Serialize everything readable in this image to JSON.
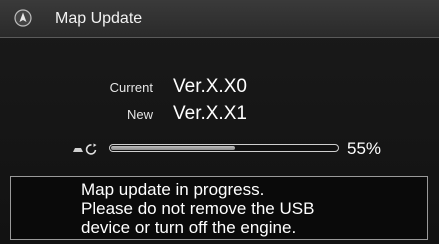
{
  "header": {
    "title": "Map Update",
    "icon": "navigation-arrow-icon"
  },
  "versions": {
    "current_label": "Current",
    "current_value": "Ver.X.X0",
    "new_label": "New",
    "new_value": "Ver.X.X1"
  },
  "progress": {
    "icon": "usb-sync-icon",
    "percent": 55,
    "percent_text": "55%"
  },
  "message": {
    "lines": [
      "Map update in progress.",
      "Please do not remove the USB",
      "device or turn off the engine."
    ]
  },
  "colors": {
    "background": "#121212",
    "header": "#2f2f2f",
    "text": "#ffffff",
    "progress_fill": "#a8a8a8"
  }
}
